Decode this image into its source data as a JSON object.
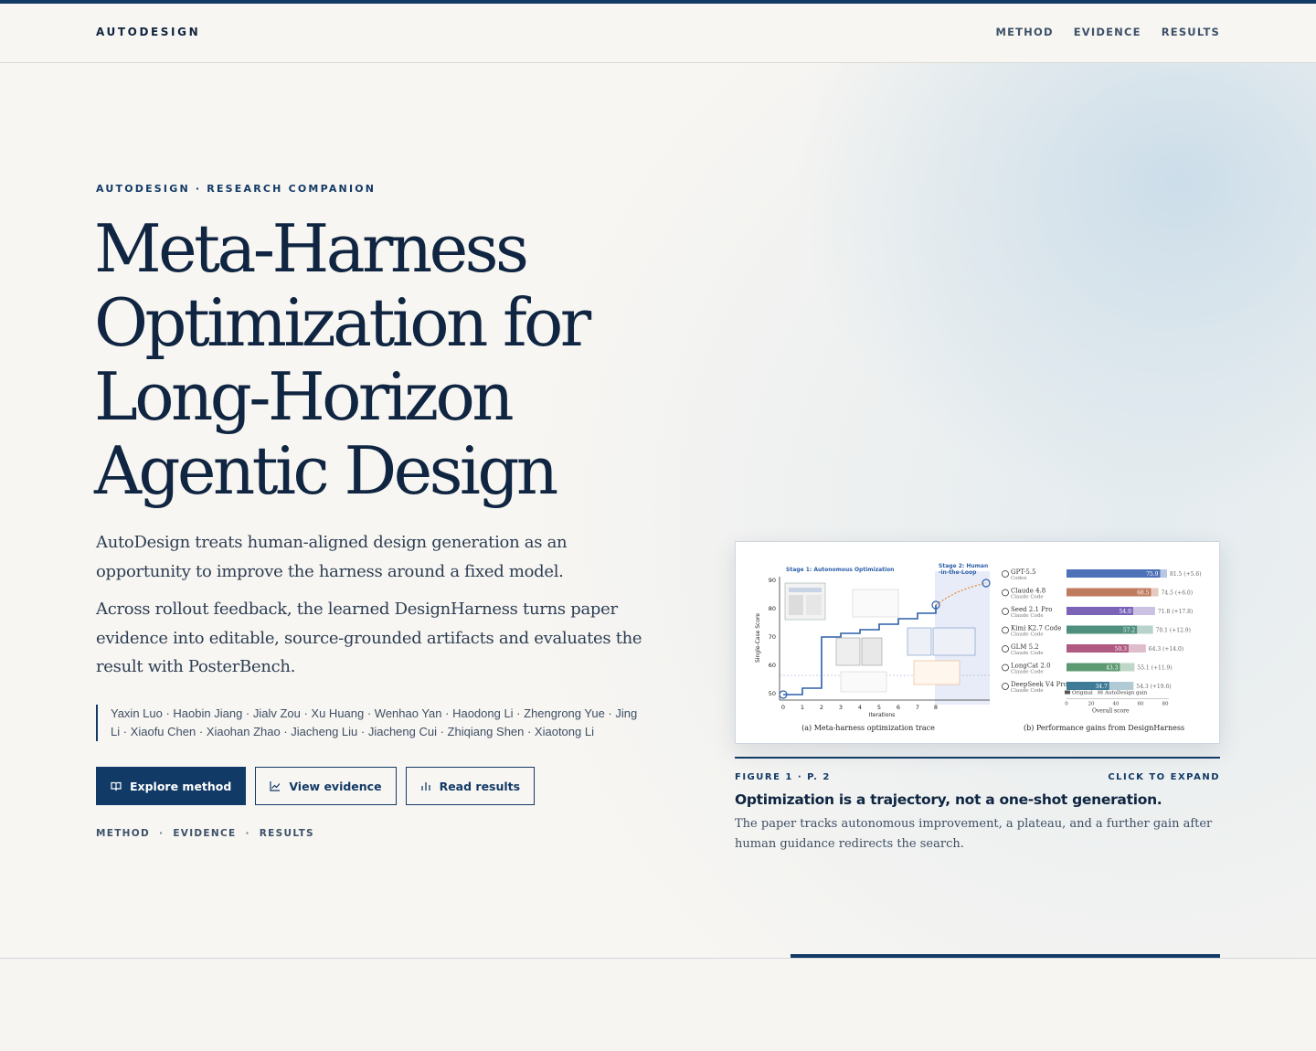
{
  "brand": "AUTODESIGN",
  "nav": {
    "items": [
      "METHOD",
      "EVIDENCE",
      "RESULTS"
    ]
  },
  "hero": {
    "eyebrow": "AUTODESIGN · RESEARCH COMPANION",
    "title_lines": [
      "Meta-Harness",
      "Optimization for",
      "Long-Horizon",
      "Agentic Design"
    ],
    "lede_1": "AutoDesign treats human-aligned design generation as an opportunity to improve the harness around a fixed model.",
    "lede_2": "Across rollout feedback, the learned DesignHarness turns paper evidence into editable, source-grounded artifacts and evaluates the result with PosterBench.",
    "authors": "Yaxin Luo · Haobin Jiang · Jialv Zou · Xu Huang · Wenhao Yan · Haodong Li · Zhengrong Yue · Jing Li · Xiaofu Chen · Xiaohan Zhao · Jiacheng Liu · Jiacheng Cui · Zhiqiang Shen · Xiaotong Li",
    "buttons": {
      "explore": "Explore method",
      "evidence": "View evidence",
      "results": "Read results"
    },
    "subnav": [
      "METHOD",
      "EVIDENCE",
      "RESULTS"
    ]
  },
  "figure": {
    "label": "FIGURE 1 · P. 2",
    "expand": "CLICK TO EXPAND",
    "title": "Optimization is a trajectory, not a one-shot generation.",
    "caption": "The paper tracks autonomous improvement, a plateau, and a further gain after human guidance redirects the search.",
    "panel_a": {
      "stage1": "Stage 1: Autonomous Optimization",
      "stage2_line1": "Stage 2: Human",
      "stage2_line2": "-in-the-Loop",
      "ylabel": "Single-Case Score",
      "xlabel": "Iterations",
      "caption": "(a) Meta-harness optimization trace",
      "yticks": [
        "90",
        "80",
        "70",
        "60",
        "50"
      ],
      "xticks": [
        "0",
        "1",
        "2",
        "3",
        "4",
        "5",
        "6",
        "7",
        "8"
      ]
    },
    "panel_b": {
      "caption": "(b) Performance gains from DesignHarness",
      "xlabel": "Overall score",
      "xticks": [
        "0",
        "20",
        "40",
        "60",
        "80"
      ],
      "legend": [
        "Original",
        "AutoDesign gain"
      ],
      "rows": [
        {
          "model": "GPT-5.5",
          "agent": "Codex",
          "original": "75.9",
          "total": "81.5 (+5.6)",
          "color": "#4e72b8"
        },
        {
          "model": "Claude 4.8",
          "agent": "Claude Code",
          "original": "68.5",
          "total": "74.5 (+6.0)",
          "color": "#c07a5e"
        },
        {
          "model": "Seed 2.1 Pro",
          "agent": "Claude Code",
          "original": "54.0",
          "total": "71.8 (+17.8)",
          "color": "#7b63b8"
        },
        {
          "model": "Kimi K2.7 Code",
          "agent": "Claude Code",
          "original": "57.2",
          "total": "70.1 (+12.9)",
          "color": "#4f8f7e"
        },
        {
          "model": "GLM 5.2",
          "agent": "Claude Code",
          "original": "50.3",
          "total": "64.3 (+14.0)",
          "color": "#b05a82"
        },
        {
          "model": "LongCat 2.0",
          "agent": "Claude Code",
          "original": "43.3",
          "total": "55.1 (+11.9)",
          "color": "#5d9a72"
        },
        {
          "model": "DeepSeek V4 Pro",
          "agent": "Claude Code",
          "original": "34.7",
          "total": "54.3 (+19.6)",
          "color": "#3f7b96"
        }
      ]
    }
  },
  "colors": {
    "accent": "#123a66",
    "ink": "#0f2541",
    "background": "#f8f6f2"
  }
}
